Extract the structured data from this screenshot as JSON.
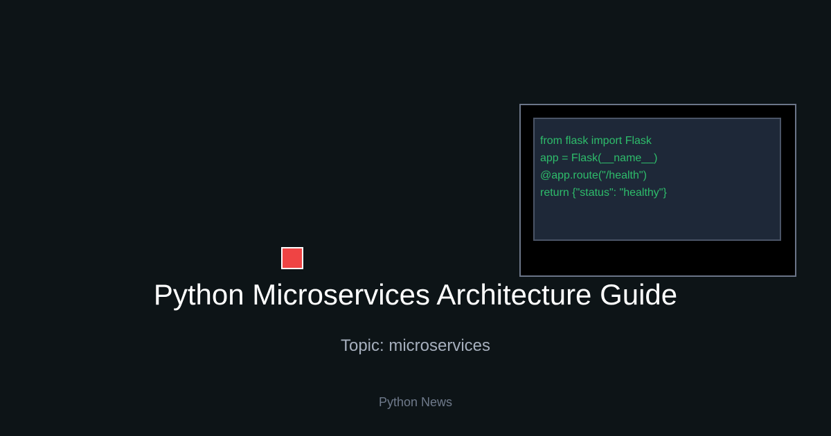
{
  "card": {
    "title": "Python Microservices Architecture Guide",
    "topic": "Topic: microservices",
    "brand": "Python News"
  },
  "code_snippet": {
    "lines": [
      "from flask import Flask",
      "app = Flask(__name__)",
      "@app.route(\"/health\")",
      "return {\"status\": \"healthy\"}"
    ]
  },
  "colors": {
    "background": "#0d1417",
    "code_text": "#2ebd6b",
    "accent_square": "#ef4444",
    "title_text": "#ffffff",
    "topic_text": "#a6afbd",
    "brand_text": "#6f7a8b"
  }
}
